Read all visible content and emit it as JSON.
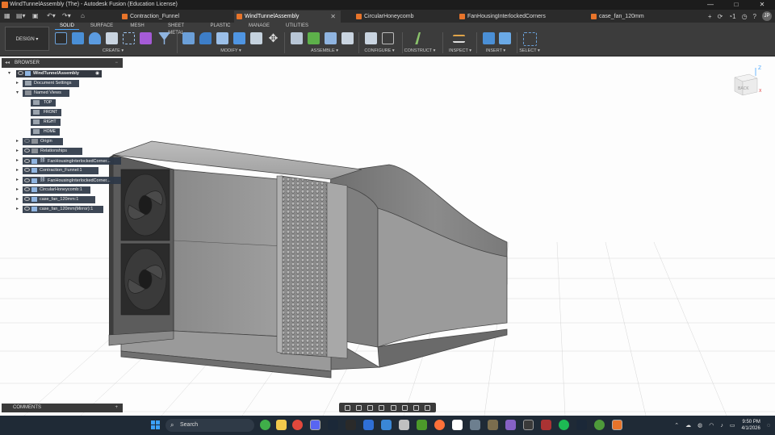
{
  "window": {
    "title": "WindTunnelAssembly (The) - Autodesk Fusion (Education License)",
    "controls": [
      "—",
      "□",
      "✕"
    ]
  },
  "tabs": [
    {
      "label": "Contraction_Funnel",
      "active": false
    },
    {
      "label": "WindTunnelAssembly",
      "active": true
    },
    {
      "label": "CircularHoneycomb",
      "active": false
    },
    {
      "label": "FanHousingInterlockedCorners",
      "active": false
    },
    {
      "label": "case_fan_120mm",
      "active": false
    }
  ],
  "header": {
    "job_count": "1",
    "avatar_initials": "JP"
  },
  "ribbon": {
    "workspace": "DESIGN ▾",
    "tabs": [
      "SOLID",
      "SURFACE",
      "MESH",
      "SHEET METAL",
      "PLASTIC",
      "MANAGE",
      "UTILITIES"
    ],
    "groups": [
      "CREATE ▾",
      "MODIFY ▾",
      "ASSEMBLE ▾",
      "CONFIGURE ▾",
      "CONSTRUCT ▾",
      "INSPECT ▾",
      "INSERT ▾",
      "SELECT ▾"
    ]
  },
  "browser": {
    "title": "BROWSER",
    "root": "WindTunnelAssembly",
    "items": [
      {
        "label": "Document Settings"
      },
      {
        "label": "Named Views"
      },
      {
        "label": "Origin"
      },
      {
        "label": "Relationships"
      },
      {
        "label": "FanHousingInterlockedCorner..."
      },
      {
        "label": "Contraction_Funnel:1"
      },
      {
        "label": "FanHousingInterlockedCorner..."
      },
      {
        "label": "CircularHoneycomb:1"
      },
      {
        "label": "case_fan_120mm:1"
      },
      {
        "label": "case_fan_120mm(Mirror):1"
      }
    ],
    "named_views": [
      "TOP",
      "FRONT",
      "RIGHT",
      "HOME"
    ]
  },
  "viewcube": {
    "face_front": "BACK",
    "axis_z": "Z",
    "axis_x": "X"
  },
  "comments": {
    "title": "COMMENTS"
  },
  "taskbar": {
    "search_placeholder": "Search",
    "time": "9:50 PM",
    "date": "4/1/2026"
  },
  "colors": {
    "accent": "#4aa8ff",
    "fusion_orange": "#e8742a",
    "ribbon_bg": "#3c3c3c"
  }
}
